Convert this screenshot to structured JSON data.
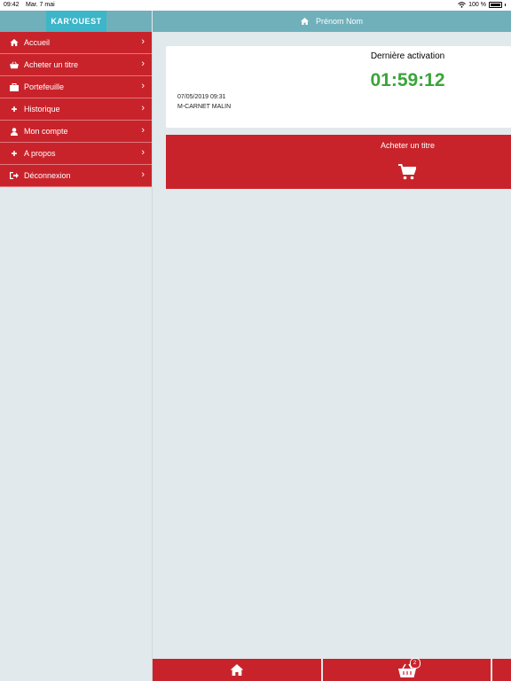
{
  "status_bar": {
    "time": "09:42",
    "date": "Mar. 7 mai",
    "battery": "100 %"
  },
  "app": {
    "logo_text": "KAR'OUEST",
    "user_name": "Prénom Nom"
  },
  "sidebar": {
    "items": [
      {
        "label": "Accueil",
        "icon": "home-icon"
      },
      {
        "label": "Acheter un titre",
        "icon": "basket-icon"
      },
      {
        "label": "Portefeuille",
        "icon": "wallet-icon"
      },
      {
        "label": "Historique",
        "icon": "plus-icon"
      },
      {
        "label": "Mon compte",
        "icon": "user-icon"
      },
      {
        "label": "A propos",
        "icon": "plus-icon"
      },
      {
        "label": "Déconnexion",
        "icon": "sign-out-icon"
      }
    ]
  },
  "activation": {
    "title": "Dernière activation",
    "timer": "01:59:12",
    "date": "07/05/2019 09:31",
    "product": "M-CARNET MALIN"
  },
  "buy": {
    "label": "Acheter un titre"
  },
  "bottom_tabs": {
    "basket_badge": "2"
  },
  "colors": {
    "primary_red": "#c8232b",
    "header_teal": "#6fb0bb",
    "logo_teal": "#3cb6c8",
    "timer_green": "#3aa53a",
    "background": "#e2e9ec"
  }
}
